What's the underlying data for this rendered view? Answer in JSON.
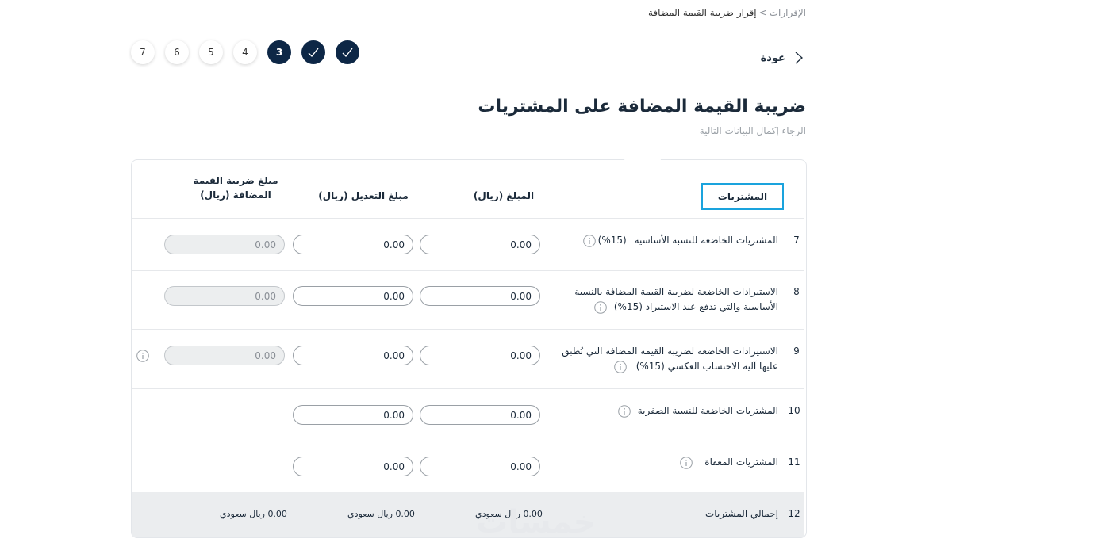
{
  "breadcrumb": {
    "root": "الإقرارات",
    "separator": ">",
    "current": "إقرار ضريبة القيمة المضافة"
  },
  "back": {
    "label": "عودة"
  },
  "stepper": {
    "steps": [
      {
        "label": "7",
        "state": "pending"
      },
      {
        "label": "6",
        "state": "pending"
      },
      {
        "label": "5",
        "state": "pending"
      },
      {
        "label": "4",
        "state": "pending"
      },
      {
        "label": "3",
        "state": "current"
      },
      {
        "label": "",
        "state": "done"
      },
      {
        "label": "",
        "state": "done"
      }
    ]
  },
  "page": {
    "title": "ضريبة القيمة المضافة على المشتريات",
    "subtitle": "الرجاء إكمال البيانات التالية"
  },
  "table": {
    "headers": {
      "purchases": "المشتريات",
      "amount": "المبلغ (ريال)",
      "adjustment": "مبلغ التعديل (ريال)",
      "vat_line1": "مبلغ ضريبة القيمة",
      "vat_line2": "المضافة (ريال)"
    },
    "rows": [
      {
        "num": "7",
        "label_line1": "المشتريات الخاضعة للنسبة الأساسية",
        "label_line2": "(15%)",
        "amount": "0.00",
        "adjustment": "0.00",
        "vat": "0.00"
      },
      {
        "num": "8",
        "label_line1": "الاستيرادات الخاضعة لضريبة القيمة المضافة بالنسبة",
        "label_line2": "الأساسية والتي تدفع عند الاستيراد (15%)",
        "amount": "0.00",
        "adjustment": "0.00",
        "vat": "0.00"
      },
      {
        "num": "9",
        "label_line1": "الاستيرادات الخاضعة لضريبة القيمة المضافة التي تُطبق",
        "label_line2": "عليها آلية الاحتساب العكسي (15%)",
        "amount": "0.00",
        "adjustment": "0.00",
        "vat": "0.00"
      },
      {
        "num": "10",
        "label_line1": "المشتريات الخاضعة للنسبة الصفرية",
        "amount": "0.00",
        "adjustment": "0.00"
      },
      {
        "num": "11",
        "label_line1": "المشتريات المعفاة",
        "amount": "0.00",
        "adjustment": "0.00"
      }
    ],
    "total": {
      "num": "12",
      "label": "إجمالي المشتريات",
      "amount": "0.00 ريال سعودي",
      "adjustment": "0.00 ريال سعودي",
      "vat": "0.00 ريال سعودي"
    }
  },
  "watermark": "خمسات",
  "colors": {
    "navy": "#0d2746",
    "highlight": "#1aa3dd",
    "total_bg": "#ebedef"
  }
}
